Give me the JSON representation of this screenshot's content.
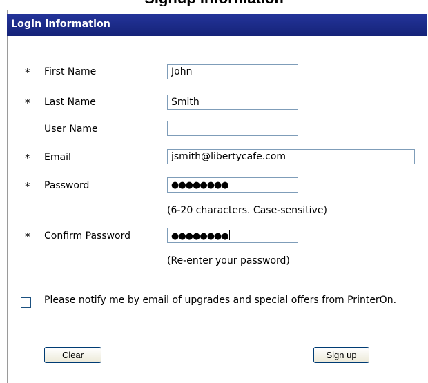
{
  "page": {
    "heading": "Signup Information"
  },
  "section": {
    "title": "Login information"
  },
  "required_marker": "*",
  "fields": [
    {
      "label": "First Name",
      "value": "John",
      "required": true
    },
    {
      "label": "Last Name",
      "value": "Smith",
      "required": true
    },
    {
      "label": "User Name",
      "value": "",
      "required": false
    },
    {
      "label": "Email",
      "value": "jsmith@libertycafe.com",
      "required": true
    },
    {
      "label": "Password",
      "value": "●●●●●●●●",
      "required": true,
      "hint": "(6-20 characters. Case-sensitive)"
    },
    {
      "label": "Confirm Password",
      "value": "●●●●●●●●",
      "required": true,
      "hint": "(Re-enter your password)"
    }
  ],
  "notify": {
    "checked": false,
    "label": "Please notify me by email of upgrades and special offers from PrinterOn."
  },
  "buttons": {
    "clear": "Clear",
    "signup": "Sign up"
  },
  "colors": {
    "header": "#1a2a8c",
    "input_border": "#7f9db9"
  }
}
